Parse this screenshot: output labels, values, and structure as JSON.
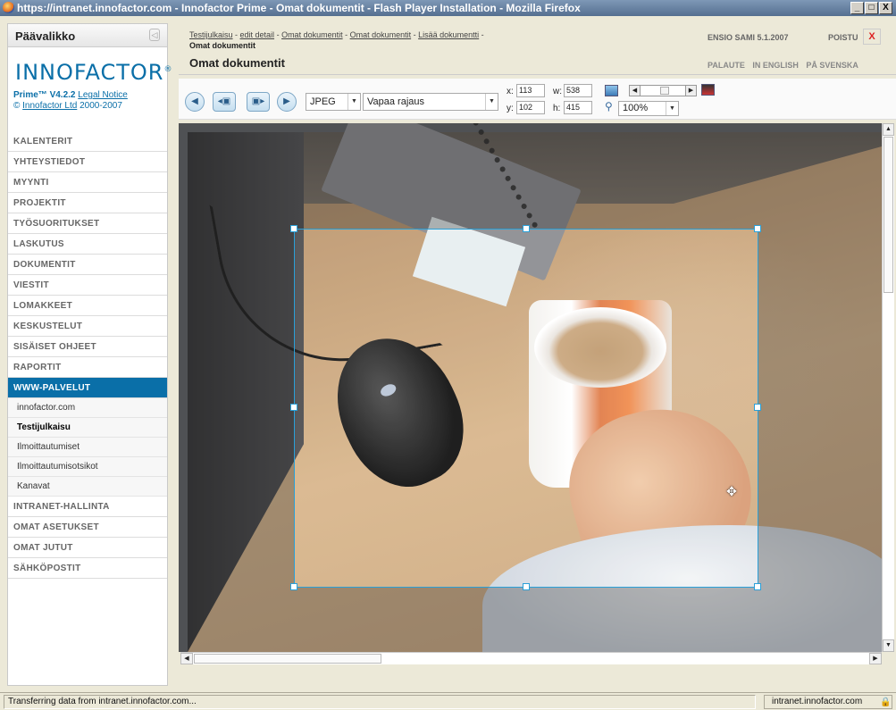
{
  "window": {
    "title": "https://intranet.innofactor.com - Innofactor Prime - Omat dokumentit - Flash Player Installation - Mozilla Firefox",
    "buttons": [
      "_",
      "□",
      "X"
    ]
  },
  "sidebar": {
    "header": "Päävalikko",
    "logo": "INNOFACTOR",
    "logo_mark": "®",
    "version": "Prime™ V4.2.2",
    "legal_link": "Legal Notice",
    "copyright_prefix": "©",
    "company_link": "Innofactor Ltd",
    "years": "2000-2007",
    "menu": [
      {
        "label": "KALENTERIT"
      },
      {
        "label": "YHTEYSTIEDOT"
      },
      {
        "label": "MYYNTI"
      },
      {
        "label": "PROJEKTIT"
      },
      {
        "label": "TYÖSUORITUKSET"
      },
      {
        "label": "LASKUTUS"
      },
      {
        "label": "DOKUMENTIT"
      },
      {
        "label": "VIESTIT"
      },
      {
        "label": "LOMAKKEET"
      },
      {
        "label": "KESKUSTELUT"
      },
      {
        "label": "SISÄISET OHJEET"
      },
      {
        "label": "RAPORTIT"
      },
      {
        "label": "WWW-PALVELUT"
      }
    ],
    "submenu": [
      {
        "label": "innofactor.com"
      },
      {
        "label": "Testijulkaisu"
      },
      {
        "label": "Ilmoittautumiset"
      },
      {
        "label": "Ilmoittautumisotsikot"
      },
      {
        "label": "Kanavat"
      }
    ],
    "menu_after": [
      {
        "label": "INTRANET-HALLINTA"
      },
      {
        "label": "OMAT ASETUKSET"
      },
      {
        "label": "OMAT JUTUT"
      },
      {
        "label": "SÄHKÖPOSTIT"
      }
    ]
  },
  "header": {
    "breadcrumbs": [
      "Testijulkaisu",
      "edit detail",
      "Omat dokumentit",
      "Omat dokumentit",
      "Lisää dokumentti"
    ],
    "separator": " - ",
    "subtitle": "Omat dokumentit",
    "page_title": "Omat dokumentit",
    "user": "ENSIO SAMI 5.1.2007",
    "logout": "POISTU",
    "close": "X",
    "links": [
      "PALAUTE",
      "IN ENGLISH",
      "PÅ SVENSKA"
    ]
  },
  "toolbar": {
    "format": "JPEG",
    "crop_mode": "Vapaa rajaus",
    "x_label": "x:",
    "x": "113",
    "y_label": "y:",
    "y": "102",
    "w_label": "w:",
    "w": "538",
    "h_label": "h:",
    "h": "415",
    "zoom": "100%"
  },
  "status": {
    "message": "Transferring data from intranet.innofactor.com...",
    "host": "intranet.innofactor.com"
  }
}
